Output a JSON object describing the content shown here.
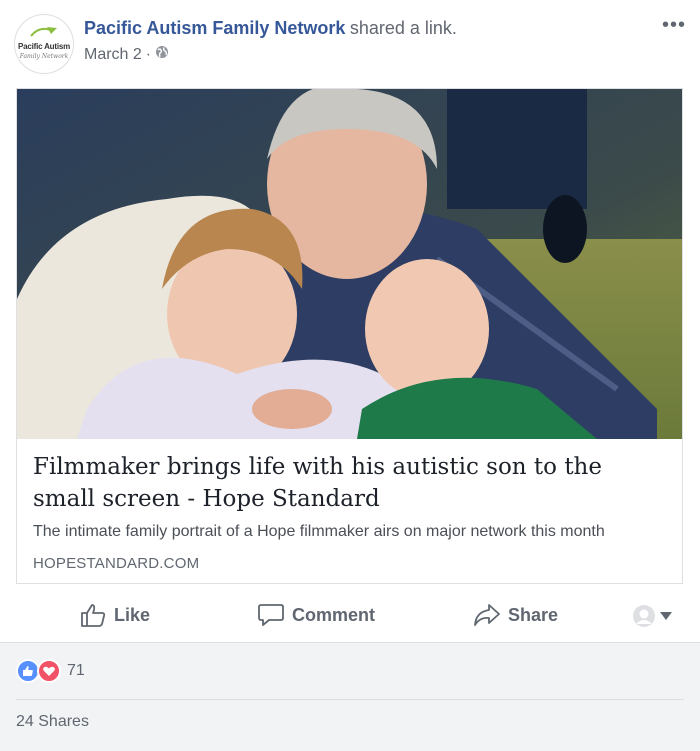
{
  "post": {
    "page_name": "Pacific Autism Family Network",
    "action_text": "shared a link.",
    "date": "March 2",
    "separator": "·",
    "more_label": "•••",
    "avatar_logo": {
      "line1": "Pacific Autism",
      "line2": "Family Network"
    }
  },
  "link_preview": {
    "title": "Filmmaker brings life with his autistic son to the small screen - Hope Standard",
    "description": "The intimate family portrait of a Hope filmmaker airs on major network this month",
    "domain": "HOPESTANDARD.COM"
  },
  "actions": {
    "like": "Like",
    "comment": "Comment",
    "share": "Share"
  },
  "stats": {
    "reaction_count": "71",
    "shares": "24 Shares"
  },
  "colors": {
    "link_blue": "#365899",
    "like_blue": "#5890ff",
    "love_red": "#f25268",
    "muted": "#606770"
  }
}
